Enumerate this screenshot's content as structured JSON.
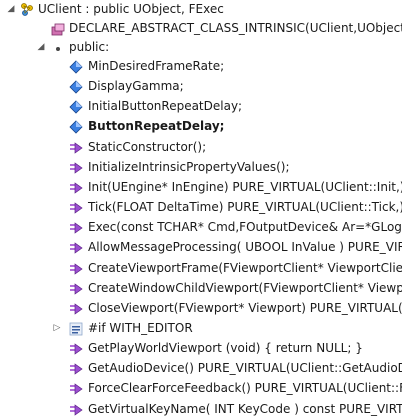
{
  "tree": {
    "class_label": "UClient : public UObject, FExec",
    "macro_label": "DECLARE_ABSTRACT_CLASS_INTRINSIC(UClient,UObject,C",
    "public_label": "public:",
    "members": [
      "MinDesiredFrameRate;",
      "DisplayGamma;",
      "InitialButtonRepeatDelay;",
      "ButtonRepeatDelay;",
      "StaticConstructor();",
      "InitializeIntrinsicPropertyValues();",
      "Init(UEngine* InEngine) PURE_VIRTUAL(UClient::Init,);",
      "Tick(FLOAT DeltaTime) PURE_VIRTUAL(UClient::Tick,);",
      "Exec(const TCHAR* Cmd,FOutputDevice& Ar=*GLog);",
      "AllowMessageProcessing( UBOOL InValue ) PURE_VIR",
      "CreateViewportFrame(FViewportClient* ViewportClien",
      "CreateWindowChildViewport(FViewportClient* Viewpo",
      "CloseViewport(FViewport* Viewport) PURE_VIRTUAL(U",
      "#if WITH_EDITOR",
      "GetPlayWorldViewport (void) { return NULL; }",
      "GetAudioDevice() PURE_VIRTUAL(UClient::GetAudioDe",
      "ForceClearForceFeedback() PURE_VIRTUAL(UClient::Fo",
      "GetVirtualKeyName( INT KeyCode ) const PURE_VIRT"
    ]
  },
  "icons": {
    "class": "class-icon",
    "macro": "macro-icon",
    "field": "field-icon",
    "method": "method-icon",
    "preprocessor": "preprocessor-icon"
  },
  "colors": {
    "field_blue": "#1f6fd6",
    "method_purple": "#8a3ab9",
    "tree_grey": "#595959"
  }
}
